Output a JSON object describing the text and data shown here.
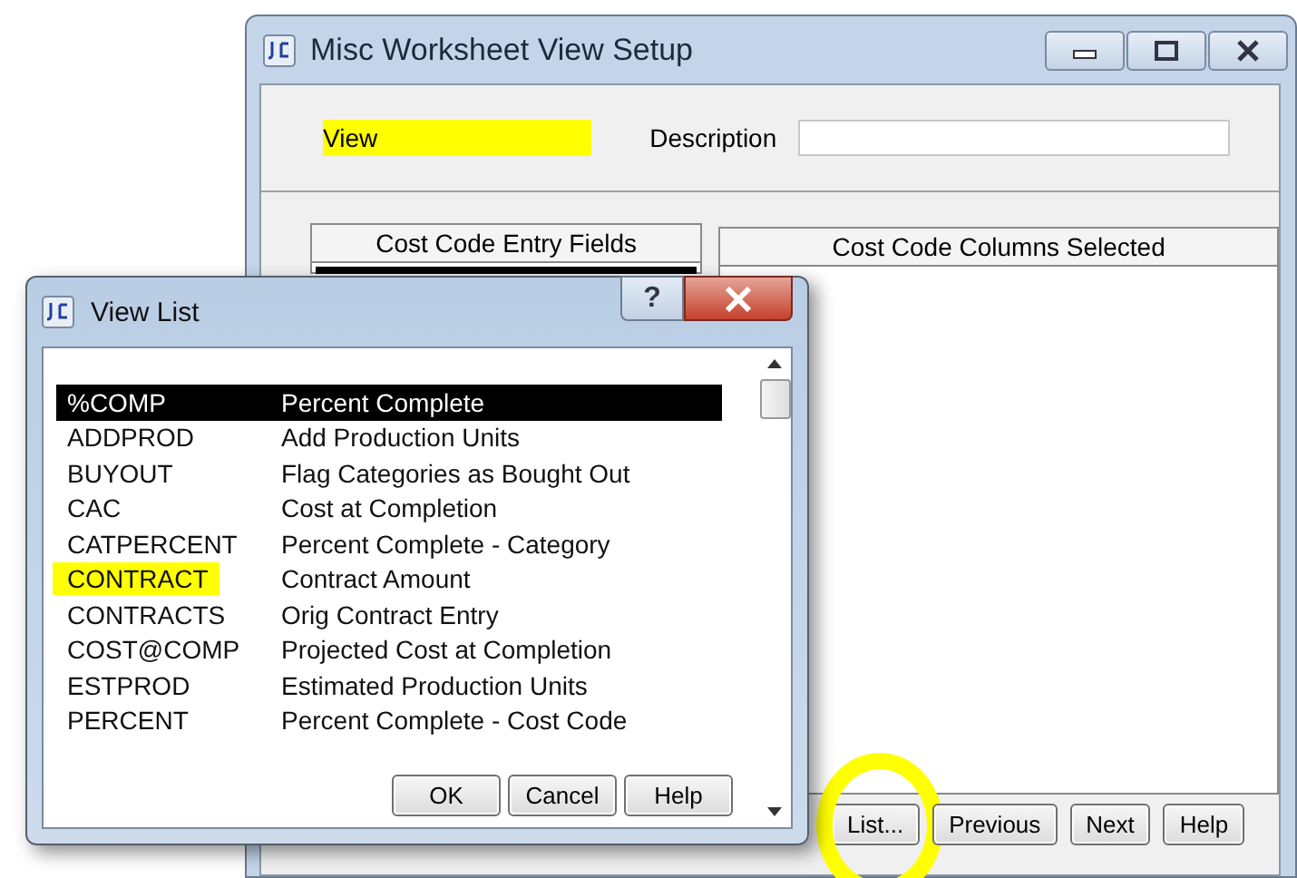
{
  "main_window": {
    "title": "Misc Worksheet View Setup",
    "view_field": {
      "label": "View",
      "highlighted": true
    },
    "description_field": {
      "label": "Description"
    },
    "panels": [
      "Cost Code Entry Fields",
      "Cost Code Columns Selected"
    ],
    "buttons": [
      {
        "label": "List...",
        "circled": true
      },
      {
        "label": "Previous",
        "circled": false
      },
      {
        "label": "Next",
        "circled": false
      },
      {
        "label": "Help",
        "circled": false
      }
    ]
  },
  "dialog": {
    "title": "View List",
    "help_glyph": "?",
    "rows": [
      {
        "code": "%COMP",
        "description": "Percent Complete",
        "selected": true,
        "highlighted": false
      },
      {
        "code": "ADDPROD",
        "description": "Add Production Units",
        "selected": false,
        "highlighted": false
      },
      {
        "code": "BUYOUT",
        "description": "Flag Categories as Bought Out",
        "selected": false,
        "highlighted": false
      },
      {
        "code": "CAC",
        "description": "Cost at Completion",
        "selected": false,
        "highlighted": false
      },
      {
        "code": "CATPERCENT",
        "description": "Percent Complete - Category",
        "selected": false,
        "highlighted": false
      },
      {
        "code": "CONTRACT",
        "description": "Contract Amount",
        "selected": false,
        "highlighted": true
      },
      {
        "code": "CONTRACTS",
        "description": "Orig Contract Entry",
        "selected": false,
        "highlighted": false
      },
      {
        "code": "COST@COMP",
        "description": "Projected Cost at Completion",
        "selected": false,
        "highlighted": false
      },
      {
        "code": "ESTPROD",
        "description": "Estimated Production Units",
        "selected": false,
        "highlighted": false
      },
      {
        "code": "PERCENT",
        "description": "Percent Complete - Cost Code",
        "selected": false,
        "highlighted": false
      }
    ],
    "buttons": [
      "OK",
      "Cancel",
      "Help"
    ]
  }
}
